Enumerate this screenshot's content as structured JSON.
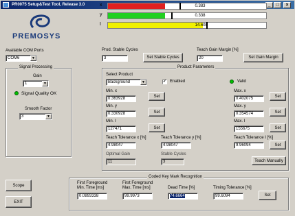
{
  "window": {
    "title": "PR0075 Setup&Test Tool, Release 3.0",
    "minimize": "_",
    "maximize": "□",
    "close": "×"
  },
  "logo": {
    "text": "PREMOSYS"
  },
  "bars": {
    "x": {
      "label": "x",
      "value": "0.383",
      "fill_fraction": 0.36,
      "color": "#e02020"
    },
    "y": {
      "label": "y",
      "value": "0.338",
      "fill_fraction": 0.36,
      "color": "#20d020"
    },
    "i": {
      "label": "I",
      "value": "14.608",
      "fill_fraction": 0.6,
      "color": "#f0f000"
    }
  },
  "com": {
    "label": "Available COM Ports",
    "selected": "COM6"
  },
  "prod_stable": {
    "label": "Prod. Stable Cycles",
    "value": "3",
    "button": "Set Stable Cycles"
  },
  "teach_gain": {
    "label": "Teach Gain Margin [%]",
    "value": "20",
    "button": "Set Gain Margin"
  },
  "signal": {
    "group": "Signal Processing",
    "gain_label": "Gain",
    "gain_value": "1",
    "quality": "Signal Quality OK",
    "smooth_label": "Smooth Factor",
    "smooth_value": "3"
  },
  "product": {
    "group": "Product Parameters",
    "select_label": "Select Product",
    "select_value": "Background",
    "enabled_label": "Enabled",
    "valid_label": "Valid",
    "min_x_label": "Min. x",
    "min_x": "0.363928",
    "min_y_label": "Min. y",
    "min_y": "0.330928",
    "min_i_label": "Min. I",
    "min_i": "127471",
    "max_x_label": "Max. x",
    "max_x": "0.402075",
    "max_y_label": "Max. y",
    "max_y": "0.354574",
    "max_i_label": "Max. I",
    "max_i": "155675",
    "set": "Set",
    "tol_x_label": "Teach Tolerance x [%]",
    "tol_x": "4.98047",
    "tol_y_label": "Teach Tolerance y [%]",
    "tol_y": "4.98047",
    "tol_i_label": "Teach Tolerance I [%]",
    "tol_i": "9.96094",
    "opt_gain_label": "Optimal Gain",
    "opt_gain": "11",
    "stable_label": "Stable Cycles",
    "stable": "3",
    "teach_manually": "Teach Manually"
  },
  "keymark": {
    "group": "Coded Key Mark Recognition",
    "first_fg_label": "First Foreground",
    "first_fg_sub": "Min. Time [ms]",
    "first_fg": "0.0893338",
    "first_fg_max_label": "First Foreground",
    "first_fg_max_sub": "Max. Time [ms]",
    "first_fg_max": "99.9973",
    "dead_label": "Dead Time [%]",
    "dead": "74.6664",
    "timing_label": "Timing Tolerance [%]",
    "timing": "99.6094",
    "set": "Set"
  },
  "scope_button": "Scope",
  "exit_button": "EXIT"
}
